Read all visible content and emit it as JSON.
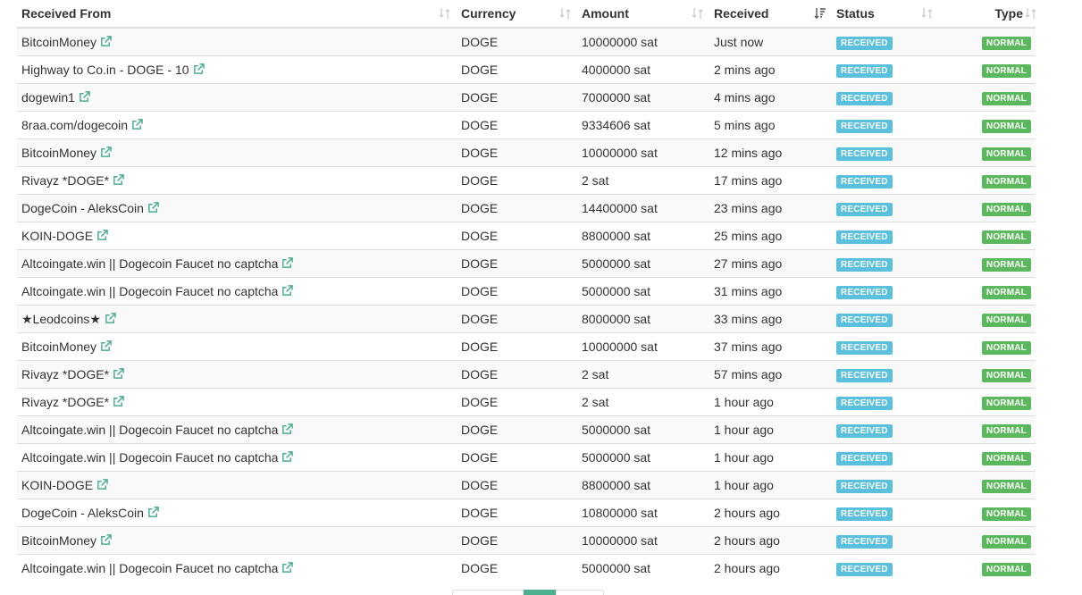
{
  "table": {
    "headers": {
      "received_from": "Received From",
      "currency": "Currency",
      "amount": "Amount",
      "received": "Received",
      "status": "Status",
      "type": "Type"
    },
    "rows": [
      {
        "from": "BitcoinMoney",
        "currency": "DOGE",
        "amount": "10000000 sat",
        "received": "Just now",
        "status": "RECEIVED",
        "type": "NORMAL"
      },
      {
        "from": "Highway to Co.in - DOGE - 10",
        "currency": "DOGE",
        "amount": "4000000 sat",
        "received": "2 mins ago",
        "status": "RECEIVED",
        "type": "NORMAL"
      },
      {
        "from": "dogewin1",
        "currency": "DOGE",
        "amount": "7000000 sat",
        "received": "4 mins ago",
        "status": "RECEIVED",
        "type": "NORMAL"
      },
      {
        "from": "8raa.com/dogecoin",
        "currency": "DOGE",
        "amount": "9334606 sat",
        "received": "5 mins ago",
        "status": "RECEIVED",
        "type": "NORMAL"
      },
      {
        "from": "BitcoinMoney",
        "currency": "DOGE",
        "amount": "10000000 sat",
        "received": "12 mins ago",
        "status": "RECEIVED",
        "type": "NORMAL"
      },
      {
        "from": "Rivayz *DOGE*",
        "currency": "DOGE",
        "amount": "2 sat",
        "received": "17 mins ago",
        "status": "RECEIVED",
        "type": "NORMAL"
      },
      {
        "from": "DogeCoin - AleksCoin",
        "currency": "DOGE",
        "amount": "14400000 sat",
        "received": "23 mins ago",
        "status": "RECEIVED",
        "type": "NORMAL"
      },
      {
        "from": "KOIN-DOGE",
        "currency": "DOGE",
        "amount": "8800000 sat",
        "received": "25 mins ago",
        "status": "RECEIVED",
        "type": "NORMAL"
      },
      {
        "from": "Altcoingate.win || Dogecoin Faucet no captcha",
        "currency": "DOGE",
        "amount": "5000000 sat",
        "received": "27 mins ago",
        "status": "RECEIVED",
        "type": "NORMAL"
      },
      {
        "from": "Altcoingate.win || Dogecoin Faucet no captcha",
        "currency": "DOGE",
        "amount": "5000000 sat",
        "received": "31 mins ago",
        "status": "RECEIVED",
        "type": "NORMAL"
      },
      {
        "from": "★Leodcoins★",
        "currency": "DOGE",
        "amount": "8000000 sat",
        "received": "33 mins ago",
        "status": "RECEIVED",
        "type": "NORMAL"
      },
      {
        "from": "BitcoinMoney",
        "currency": "DOGE",
        "amount": "10000000 sat",
        "received": "37 mins ago",
        "status": "RECEIVED",
        "type": "NORMAL"
      },
      {
        "from": "Rivayz *DOGE*",
        "currency": "DOGE",
        "amount": "2 sat",
        "received": "57 mins ago",
        "status": "RECEIVED",
        "type": "NORMAL"
      },
      {
        "from": "Rivayz *DOGE*",
        "currency": "DOGE",
        "amount": "2 sat",
        "received": "1 hour ago",
        "status": "RECEIVED",
        "type": "NORMAL"
      },
      {
        "from": "Altcoingate.win || Dogecoin Faucet no captcha",
        "currency": "DOGE",
        "amount": "5000000 sat",
        "received": "1 hour ago",
        "status": "RECEIVED",
        "type": "NORMAL"
      },
      {
        "from": "Altcoingate.win || Dogecoin Faucet no captcha",
        "currency": "DOGE",
        "amount": "5000000 sat",
        "received": "1 hour ago",
        "status": "RECEIVED",
        "type": "NORMAL"
      },
      {
        "from": "KOIN-DOGE",
        "currency": "DOGE",
        "amount": "8800000 sat",
        "received": "1 hour ago",
        "status": "RECEIVED",
        "type": "NORMAL"
      },
      {
        "from": "DogeCoin - AleksCoin",
        "currency": "DOGE",
        "amount": "10800000 sat",
        "received": "2 hours ago",
        "status": "RECEIVED",
        "type": "NORMAL"
      },
      {
        "from": "BitcoinMoney",
        "currency": "DOGE",
        "amount": "10000000 sat",
        "received": "2 hours ago",
        "status": "RECEIVED",
        "type": "NORMAL"
      },
      {
        "from": "Altcoingate.win || Dogecoin Faucet no captcha",
        "currency": "DOGE",
        "amount": "5000000 sat",
        "received": "2 hours ago",
        "status": "RECEIVED",
        "type": "NORMAL"
      }
    ]
  },
  "icons": {
    "external_link": "external-link-icon",
    "sort": "sort-icon",
    "sort_active": "sort-desc-icon"
  },
  "colors": {
    "status_badge": "#5bc0de",
    "type_badge": "#5cb85c",
    "link_icon": "#4caf8f",
    "pagination_active": "#4caf8f"
  }
}
